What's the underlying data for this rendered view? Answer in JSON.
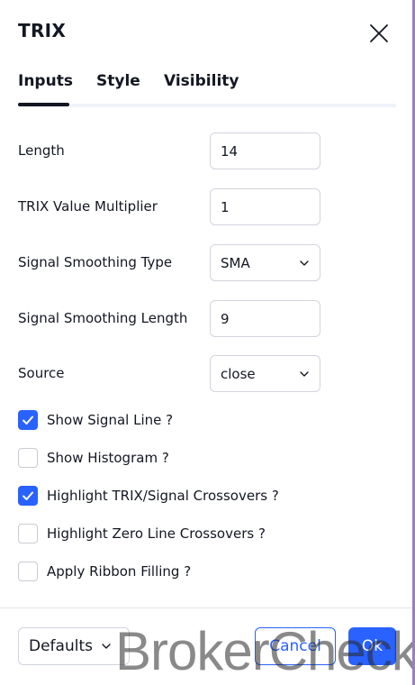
{
  "dialog": {
    "title": "TRIX"
  },
  "tabs": [
    {
      "label": "Inputs",
      "active": true
    },
    {
      "label": "Style",
      "active": false
    },
    {
      "label": "Visibility",
      "active": false
    }
  ],
  "inputs": {
    "length": {
      "label": "Length",
      "value": "14"
    },
    "multiplier": {
      "label": "TRIX Value Multiplier",
      "value": "1"
    },
    "smoothing_type": {
      "label": "Signal Smoothing Type",
      "value": "SMA"
    },
    "smoothing_length": {
      "label": "Signal Smoothing Length",
      "value": "9"
    },
    "source": {
      "label": "Source",
      "value": "close"
    }
  },
  "checkboxes": [
    {
      "label": "Show Signal Line ?",
      "checked": true
    },
    {
      "label": "Show Histogram ?",
      "checked": false
    },
    {
      "label": "Highlight TRIX/Signal Crossovers ?",
      "checked": true
    },
    {
      "label": "Highlight Zero Line Crossovers ?",
      "checked": false
    },
    {
      "label": "Apply Ribbon Filling ?",
      "checked": false
    }
  ],
  "footer": {
    "defaults_label": "Defaults",
    "cancel_label": "Cancel",
    "ok_label": "Ok"
  },
  "watermark": "BrokerCheck",
  "colors": {
    "accent": "#2962ff",
    "text": "#131722",
    "border": "#d1d4dc"
  },
  "icons": {
    "close": "close-icon",
    "chevron": "chevron-down-icon",
    "check": "checkmark-icon"
  }
}
